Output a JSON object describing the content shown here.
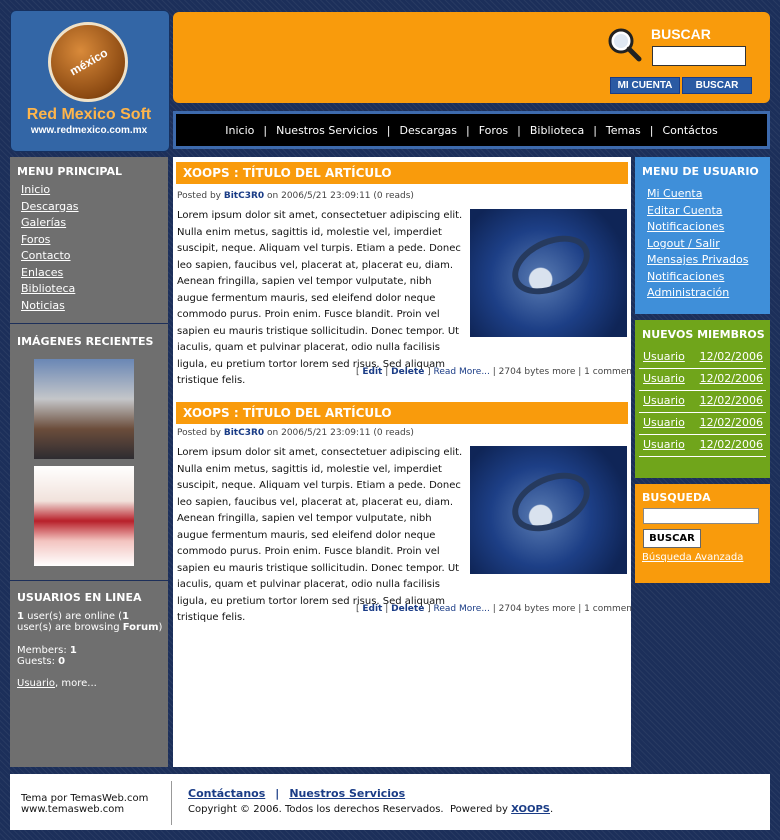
{
  "header": {
    "site_name": "Red Mexico Soft",
    "site_url": "www.redmexico.com.mx",
    "logo_text": "méxico",
    "search_label": "BUSCAR",
    "search_value": "",
    "mi_cuenta_button": "MI CUENTA",
    "buscar_button": "BUSCAR"
  },
  "nav": {
    "items": [
      "Inicio",
      "Nuestros Servicios",
      "Descargas",
      "Foros",
      "Biblioteca",
      "Temas",
      "Contáctos"
    ],
    "separator": "|"
  },
  "left_sidebar": {
    "menu_title": "MENU PRINCIPAL",
    "menu_items": [
      "Inicio",
      "Descargas",
      "Galerías",
      "Foros",
      "Contacto",
      "Enlaces",
      "Biblioteca",
      "Noticias"
    ],
    "images_title": "IMÁGENES RECIENTES",
    "online_title": "USUARIOS EN LINEA",
    "online": {
      "line1_count": "1",
      "line1_a": " user(s) are online (",
      "line1_count2": "1",
      "line1_b": " user(s) are browsing ",
      "line1_module": "Forum",
      "line1_c": ")",
      "members_label": "Members: ",
      "members_count": "1",
      "guests_label": "Guests: ",
      "guests_count": "0",
      "usuario_link": "Usuario",
      "more_link": ", more..."
    }
  },
  "articles": [
    {
      "title": "XOOPS : TÍTULO DEL ARTÍCULO",
      "posted_prefix": "Posted by ",
      "author": "BitC3R0",
      "posted_suffix": " on 2006/5/21 23:09:11 (0 reads)",
      "body": "Lorem ipsum dolor sit amet, consectetuer adipiscing elit. Nulla enim metus, sagittis id, molestie vel, imperdiet suscipit, neque. Aliquam vel turpis. Etiam a pede. Donec leo sapien, faucibus vel, placerat at, placerat eu, diam. Aenean fringilla, sapien vel tempor vulputate, nibh augue fermentum mauris, sed eleifend dolor neque commodo purus. Proin enim. Fusce blandit. Proin vel sapien eu mauris tristique sollicitudin. Donec tempor. Ut iaculis, quam et pulvinar placerat, odio nulla facilisis ligula, eu pretium tortor lorem sed risus. Sed aliquam tristique felis.",
      "edit": "Edit",
      "delete": "Delete",
      "read_more": "Read More...",
      "bytes": "2704 bytes more",
      "comments": "1 commen"
    },
    {
      "title": "XOOPS : TÍTULO DEL ARTÍCULO",
      "posted_prefix": "Posted by ",
      "author": "BitC3R0",
      "posted_suffix": " on 2006/5/21 23:09:11 (0 reads)",
      "body": "Lorem ipsum dolor sit amet, consectetuer adipiscing elit. Nulla enim metus, sagittis id, molestie vel, imperdiet suscipit, neque. Aliquam vel turpis. Etiam a pede. Donec leo sapien, faucibus vel, placerat at, placerat eu, diam. Aenean fringilla, sapien vel tempor vulputate, nibh augue fermentum mauris, sed eleifend dolor neque commodo purus. Proin enim. Fusce blandit. Proin vel sapien eu mauris tristique sollicitudin. Donec tempor. Ut iaculis, quam et pulvinar placerat, odio nulla facilisis ligula, eu pretium tortor lorem sed risus. Sed aliquam tristique felis.",
      "edit": "Edit",
      "delete": "Delete",
      "read_more": "Read More...",
      "bytes": "2704 bytes more",
      "comments": "1 commen"
    }
  ],
  "right_sidebar": {
    "user_menu_title": "MENU DE USUARIO",
    "user_menu_items": [
      "Mi Cuenta",
      "Editar Cuenta",
      "Notificaciones",
      "Logout / Salir",
      "Mensajes Privados",
      "Notificaciones",
      "Administración"
    ],
    "new_members_title": "NUEVOS MIEMBROS",
    "new_members": [
      {
        "name": "Usuario",
        "date": "12/02/2006"
      },
      {
        "name": "Usuario",
        "date": "12/02/2006"
      },
      {
        "name": "Usuario",
        "date": "12/02/2006"
      },
      {
        "name": "Usuario",
        "date": "12/02/2006"
      },
      {
        "name": "Usuario",
        "date": "12/02/2006"
      }
    ],
    "search_title": "BUSQUEDA",
    "search_value": "",
    "search_button": "BUSCAR",
    "advanced_search": "Búsqueda Avanzada"
  },
  "footer": {
    "theme_line1": "Tema por TemasWeb.com",
    "theme_line2": "www.temasweb.com",
    "contact_link": "Contáctanos",
    "separator": "|",
    "services_link": "Nuestros Servicios",
    "copyright": "Copyright © 2006. Todos los derechos Reservados.  Powered by ",
    "powered_link": "XOOPS",
    "period": "."
  },
  "colors": {
    "orange": "#f99b0c",
    "blue": "#3f8fd9",
    "green": "#70a51b",
    "gray": "#6f6f6f",
    "navy": "#1c2f5a"
  }
}
